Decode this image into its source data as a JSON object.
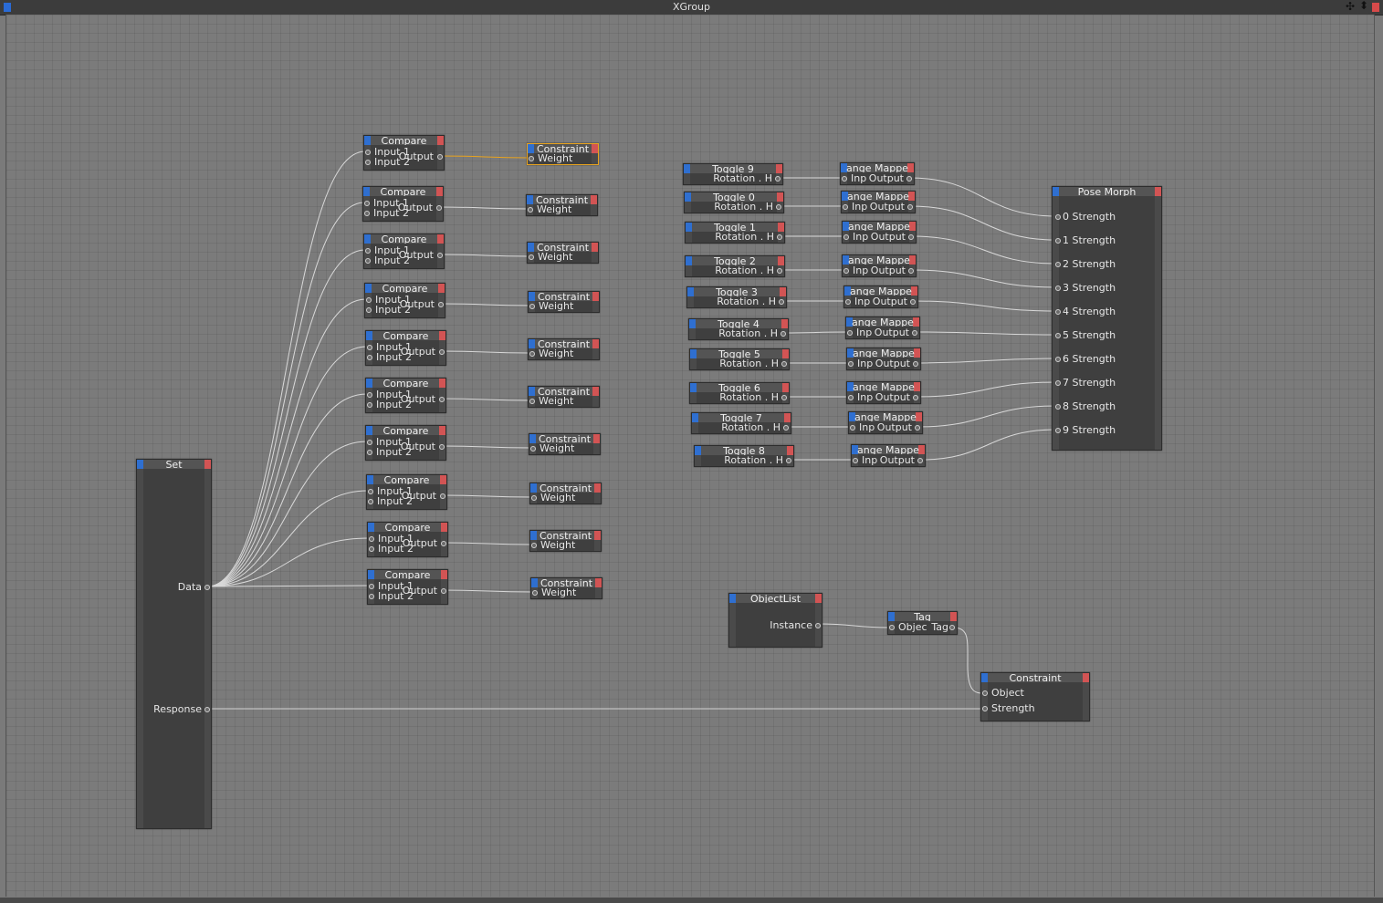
{
  "window": {
    "title": "XGroup"
  },
  "nodes": {
    "set": {
      "title": "Set",
      "ports": [
        "Data",
        "Response"
      ]
    },
    "compare": {
      "title": "Compare",
      "in1": "Input 1",
      "in2": "Input 2",
      "out": "Output"
    },
    "constraint_small": {
      "title": "Constraint",
      "port": "Weight"
    },
    "toggles": [
      {
        "title": "Toggle 9",
        "port": "Rotation . H"
      },
      {
        "title": "Toggle 0",
        "port": "Rotation . H"
      },
      {
        "title": "Toggle 1",
        "port": "Rotation . H"
      },
      {
        "title": "Toggle 2",
        "port": "Rotation . H"
      },
      {
        "title": "Toggle 3",
        "port": "Rotation . H"
      },
      {
        "title": "Toggle 4",
        "port": "Rotation . H"
      },
      {
        "title": "Toggle 5",
        "port": "Rotation . H"
      },
      {
        "title": "Toggle 6",
        "port": "Rotation . H"
      },
      {
        "title": "Toggle 7",
        "port": "Rotation . H"
      },
      {
        "title": "Toggle 8",
        "port": "Rotation . H"
      }
    ],
    "range_mapper": {
      "title": "ange Mappe",
      "in": "Inp",
      "out": "Output"
    },
    "pose_morph": {
      "title": "Pose Morph",
      "ports": [
        "0 Strength",
        "1 Strength",
        "2 Strength",
        "3 Strength",
        "4 Strength",
        "5 Strength",
        "6 Strength",
        "7 Strength",
        "8 Strength",
        "9 Strength"
      ]
    },
    "object_list": {
      "title": "ObjectList",
      "port": "Instance"
    },
    "tag": {
      "title": "Tag",
      "in": "Objec",
      "out": "Tag"
    },
    "constraint_main": {
      "title": "Constraint",
      "ports": [
        "Object",
        "Strength"
      ]
    }
  }
}
